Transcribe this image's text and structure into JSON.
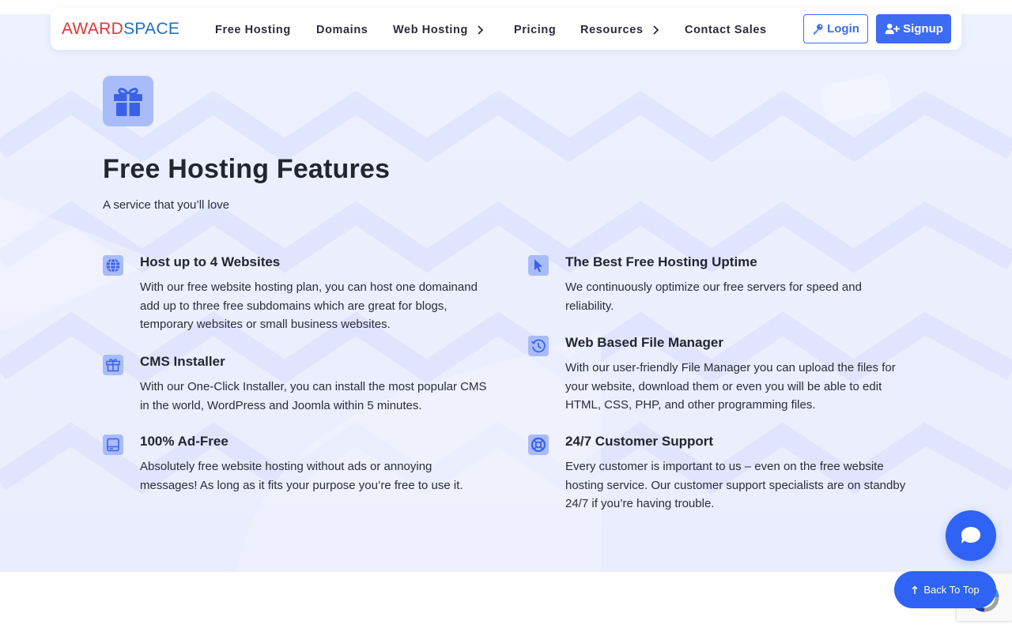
{
  "brand": {
    "logo_part1": "AWARD",
    "logo_part2": "SPACE"
  },
  "nav": {
    "items": [
      {
        "label": "Free Hosting",
        "has_submenu": false
      },
      {
        "label": "Domains",
        "has_submenu": false
      },
      {
        "label": "Web Hosting",
        "has_submenu": true
      },
      {
        "label": "Pricing",
        "has_submenu": false
      },
      {
        "label": "Resources",
        "has_submenu": true
      },
      {
        "label": "Contact Sales",
        "has_submenu": false
      }
    ],
    "login_label": "Login",
    "signup_label": "Signup"
  },
  "section": {
    "title": "Free Hosting Features",
    "subtitle": "A service that you’ll love",
    "icon": "gift-icon"
  },
  "features": [
    {
      "icon": "globe-icon",
      "title": "Host up to 4 Websites",
      "text": "With our free website hosting plan, you can host one domainand add up to three free subdomains which are great for blogs, temporary websites or small business websites."
    },
    {
      "icon": "cursor-icon",
      "title": "The Best Free Hosting Uptime",
      "text": "We continuously optimize our free servers for speed and reliability."
    },
    {
      "icon": "gift-icon",
      "title": "CMS Installer",
      "text": "With our One-Click Installer, you can install the most popular CMS in the world, WordPress and Joomla within 5 minutes."
    },
    {
      "icon": "history-icon",
      "title": "Web Based File Manager",
      "text": "With our user-friendly File Manager you can upload the files for your website, download them or even you will be able to edit HTML, CSS, PHP, and other programming files."
    },
    {
      "icon": "hard-drive-icon",
      "title": "100% Ad-Free",
      "text": "Absolutely free website hosting without ads or annoying messages! As long as it fits your purpose you’re free to use it."
    },
    {
      "icon": "lifebuoy-icon",
      "title": "24/7 Customer Support",
      "text": "Every customer is important to us – even on the free website hosting service. Our customer support specialists are on standby 24/7 if you’re having trouble."
    }
  ],
  "floating": {
    "back_to_top_label": "Back To Top",
    "chat_icon": "chat-bubble-icon"
  },
  "colors": {
    "accent": "#3d6bf2",
    "icon_bg": "#a9bcfa",
    "hero_bg": "#eef1fe",
    "logo_red": "#e0363c",
    "logo_blue": "#1f6fbf"
  }
}
